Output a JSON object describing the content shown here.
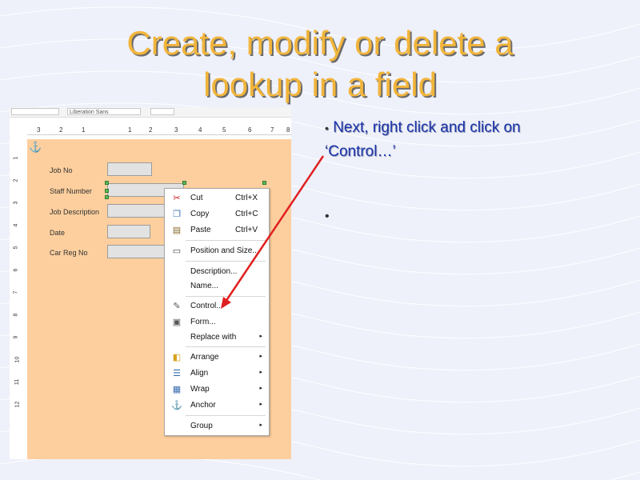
{
  "title": {
    "line1": "Create, modify or delete a",
    "line2": "lookup in a field"
  },
  "bullets": {
    "first_line1": "Next, right click and click on",
    "first_line2": "‘Control…’",
    "dot": "•",
    "second": "•"
  },
  "screenshot": {
    "toolbar": {
      "box1": "",
      "box2": "Liberation Sans"
    },
    "ruler_ticks": [
      "3",
      "2",
      "1",
      "1",
      "2",
      "3",
      "4",
      "5",
      "6",
      "7",
      "8"
    ],
    "vruler_ticks": [
      "1",
      "2",
      "3",
      "4",
      "5",
      "6",
      "7",
      "8",
      "9",
      "10",
      "11",
      "12"
    ],
    "anchor_icon": "anchor-icon",
    "fields": [
      {
        "label": "Job No"
      },
      {
        "label": "Staff Number"
      },
      {
        "label": "Job Description"
      },
      {
        "label": "Date"
      },
      {
        "label": "Car Reg No"
      }
    ]
  },
  "context_menu": {
    "items": [
      {
        "icon": "scissors-icon",
        "label": "Cut",
        "shortcut": "Ctrl+X"
      },
      {
        "icon": "copy-icon",
        "label": "Copy",
        "shortcut": "Ctrl+C"
      },
      {
        "icon": "paste-icon",
        "label": "Paste",
        "shortcut": "Ctrl+V"
      },
      {
        "icon": "position-size-icon",
        "label": "Position and Size..."
      },
      {
        "label": "Description..."
      },
      {
        "label": "Name..."
      },
      {
        "icon": "control-icon",
        "label": "Control..."
      },
      {
        "icon": "form-icon",
        "label": "Form..."
      },
      {
        "label": "Replace with",
        "submenu": true
      },
      {
        "icon": "arrange-icon",
        "label": "Arrange",
        "submenu": true
      },
      {
        "icon": "align-icon",
        "label": "Align",
        "submenu": true
      },
      {
        "icon": "wrap-icon",
        "label": "Wrap",
        "submenu": true
      },
      {
        "icon": "anchor-icon",
        "label": "Anchor",
        "submenu": true
      },
      {
        "label": "Group",
        "submenu": true
      }
    ],
    "submenu_arrow": "▸"
  },
  "colors": {
    "title": "#f2b53a",
    "bullet": "#1a33a8",
    "arrow": "#e02020",
    "page": "#fdcf9e"
  }
}
